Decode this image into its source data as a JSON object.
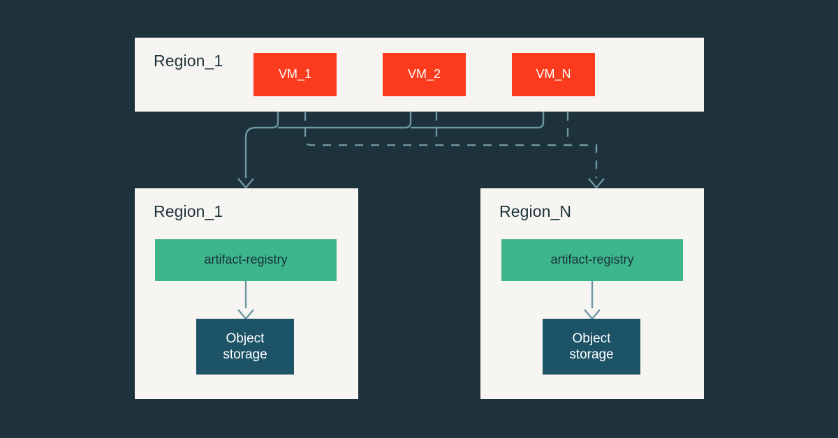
{
  "diagram": {
    "background_color": "#1d323b",
    "panel_color": "#f7f5f1",
    "accent_colors": {
      "vm": "#fb3b1e",
      "registry": "#3db68b",
      "storage": "#1c5366",
      "connector": "#6f96a3"
    }
  },
  "top_region": {
    "title": "Region_1",
    "vms": [
      {
        "label": "VM_1"
      },
      {
        "label": "VM_2"
      },
      {
        "label": "VM_N"
      }
    ]
  },
  "regions": [
    {
      "title": "Region_1",
      "registry": {
        "label": "artifact-registry"
      },
      "storage": {
        "line1": "Object",
        "line2": "storage"
      }
    },
    {
      "title": "Region_N",
      "registry": {
        "label": "artifact-registry"
      },
      "storage": {
        "line1": "Object",
        "line2": "storage"
      }
    }
  ]
}
